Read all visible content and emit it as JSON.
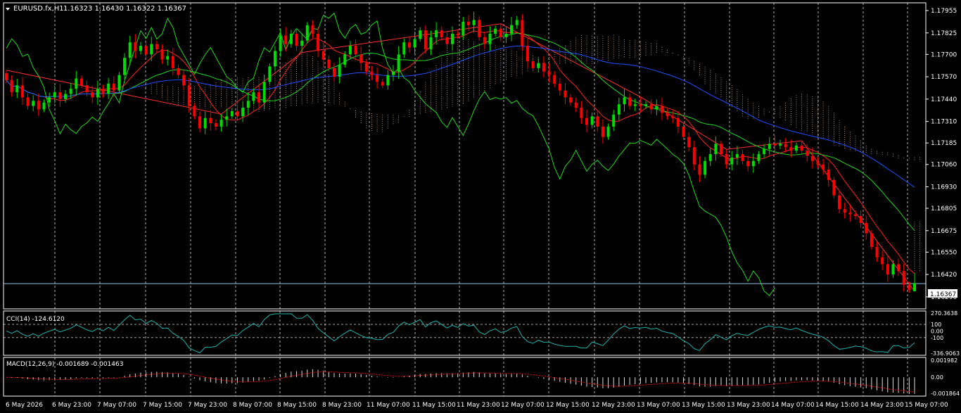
{
  "header": {
    "symbol": "EURUSD.fx,H1",
    "ohlc": "1.16323 1.16430 1.16322 1.16367"
  },
  "colors": {
    "background": "#000000",
    "bull": "#00dd00",
    "bear": "#ff0000",
    "grid": "#cfcfcf",
    "cloud": "#f0c8a0",
    "ma_red": "#ff2020",
    "ma_green": "#20d820",
    "ma_blue": "#2050ff",
    "chikou": "#20d820",
    "cci": "#20b2aa",
    "macd": "#e0e0e0",
    "signal": "#ff0000",
    "bid_line": "#8fbcdf"
  },
  "price_axis": {
    "ticks": [
      "1.17955",
      "1.17825",
      "1.17700",
      "1.17570",
      "1.17440",
      "1.17310",
      "1.17185",
      "1.17060",
      "1.16930",
      "1.16805",
      "1.16675",
      "1.16550",
      "1.16420",
      "1.16290"
    ],
    "current": "1.16367"
  },
  "time_axis": {
    "labels": [
      "6 May 2026",
      "6 May 23:00",
      "7 May 07:00",
      "7 May 15:00",
      "7 May 23:00",
      "8 May 07:00",
      "8 May 15:00",
      "8 May 23:00",
      "11 May 07:00",
      "11 May 15:00",
      "11 May 23:00",
      "12 May 07:00",
      "12 May 15:00",
      "12 May 23:00",
      "13 May 07:00",
      "13 May 15:00",
      "13 May 23:00",
      "14 May 07:00",
      "14 May 15:00",
      "14 May 23:00",
      "15 May 07:00"
    ]
  },
  "cci": {
    "title": "CCI(14) -124.6120",
    "ticks": [
      "270.3638",
      "100",
      "0.00",
      "-100",
      "-336.9063"
    ]
  },
  "macd": {
    "title": "MACD(12,26,9) -0.001689 -0.001463",
    "ticks": [
      "0.001982",
      "0.00",
      "-0.001864"
    ]
  },
  "chart_data": {
    "type": "candlestick",
    "symbol": "EURUSD.fx",
    "timeframe": "H1",
    "ylim": [
      1.1622,
      1.18
    ],
    "last": {
      "open": 1.16323,
      "high": 1.1643,
      "low": 1.16322,
      "close": 1.16367
    },
    "close": [
      1.1755,
      1.1748,
      1.1752,
      1.1745,
      1.174,
      1.1743,
      1.1738,
      1.1742,
      1.1745,
      1.1748,
      1.1744,
      1.1747,
      1.175,
      1.1756,
      1.1752,
      1.1748,
      1.1745,
      1.175,
      1.1747,
      1.1753,
      1.1749,
      1.1758,
      1.1768,
      1.1777,
      1.1772,
      1.1775,
      1.177,
      1.1776,
      1.1773,
      1.1767,
      1.1769,
      1.1762,
      1.1758,
      1.1752,
      1.174,
      1.1734,
      1.1727,
      1.1733,
      1.173,
      1.1728,
      1.1732,
      1.1734,
      1.1737,
      1.1734,
      1.1739,
      1.1743,
      1.1748,
      1.1742,
      1.1754,
      1.1763,
      1.1772,
      1.1781,
      1.1776,
      1.1782,
      1.1775,
      1.1778,
      1.1787,
      1.1782,
      1.1772,
      1.1767,
      1.1762,
      1.1757,
      1.1764,
      1.177,
      1.1775,
      1.177,
      1.1765,
      1.176,
      1.1758,
      1.1754,
      1.1752,
      1.1758,
      1.176,
      1.177,
      1.1777,
      1.1774,
      1.1779,
      1.1784,
      1.1773,
      1.178,
      1.1784,
      1.178,
      1.1776,
      1.1782,
      1.1781,
      1.1789,
      1.1787,
      1.179,
      1.178,
      1.1776,
      1.1782,
      1.1785,
      1.178,
      1.1782,
      1.1787,
      1.179,
      1.1775,
      1.1766,
      1.1762,
      1.1765,
      1.176,
      1.1758,
      1.1753,
      1.1749,
      1.1745,
      1.1742,
      1.1739,
      1.1733,
      1.1729,
      1.1734,
      1.1728,
      1.1722,
      1.1728,
      1.1735,
      1.1741,
      1.1745,
      1.174,
      1.1741,
      1.174,
      1.1741,
      1.1738,
      1.174,
      1.1736,
      1.1734,
      1.1733,
      1.1728,
      1.1722,
      1.1716,
      1.1706,
      1.17,
      1.1708,
      1.1712,
      1.1718,
      1.1712,
      1.1706,
      1.171,
      1.1712,
      1.1708,
      1.1705,
      1.1708,
      1.1712,
      1.1715,
      1.1718,
      1.1717,
      1.1718,
      1.1716,
      1.1714,
      1.1717,
      1.1714,
      1.1711,
      1.1708,
      1.1706,
      1.1703,
      1.1697,
      1.1688,
      1.168,
      1.1678,
      1.1677,
      1.1676,
      1.1672,
      1.1666,
      1.1658,
      1.1652,
      1.1648,
      1.1642,
      1.1648,
      1.1644,
      1.1636,
      1.1633,
      1.1637
    ]
  }
}
